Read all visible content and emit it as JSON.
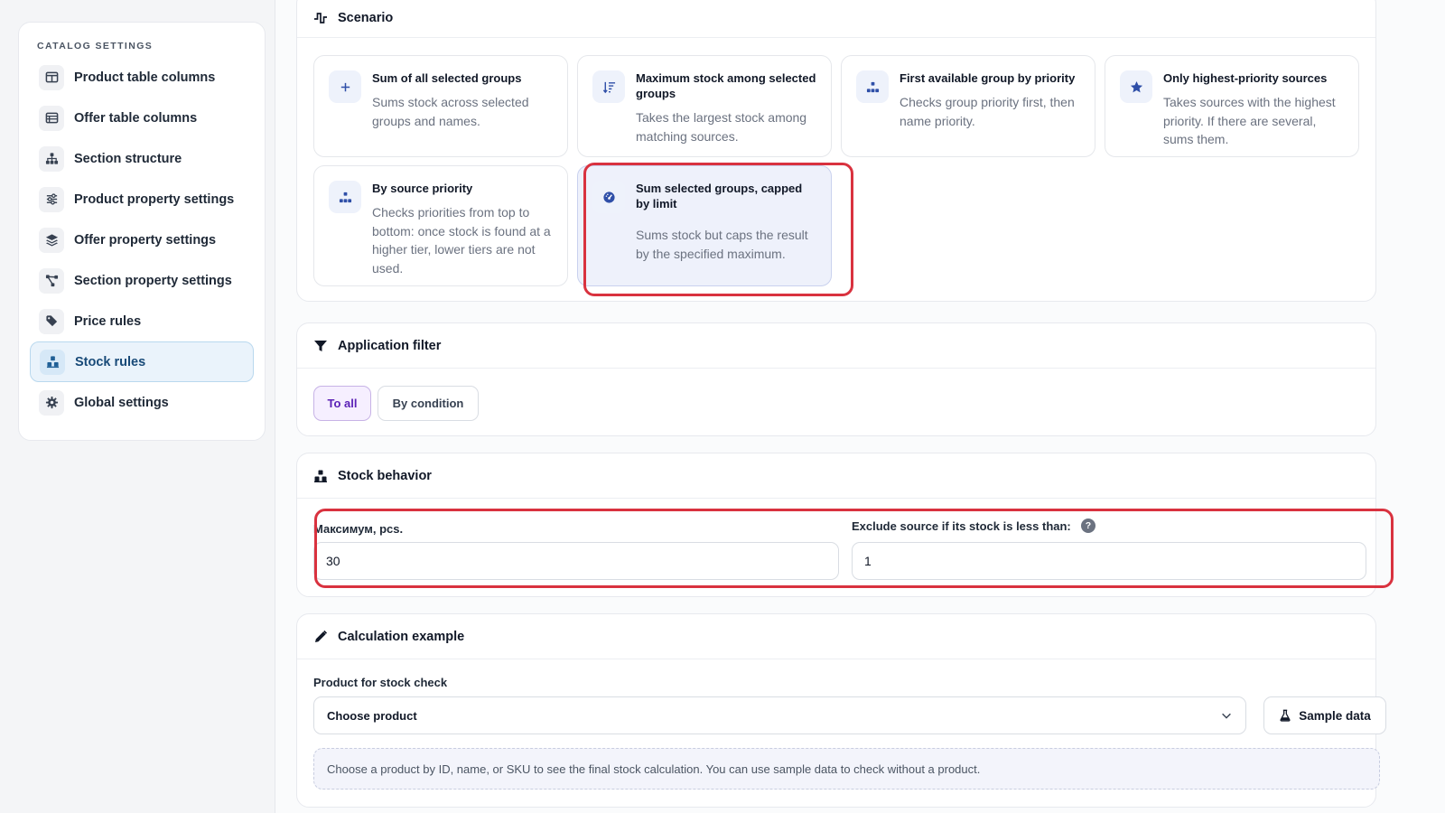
{
  "sidebar": {
    "title": "CATALOG SETTINGS",
    "items": [
      {
        "label": "Product table columns",
        "icon": "table-columns-icon"
      },
      {
        "label": "Offer table columns",
        "icon": "table-list-icon"
      },
      {
        "label": "Section structure",
        "icon": "sitemap-icon"
      },
      {
        "label": "Product property settings",
        "icon": "sliders-icon"
      },
      {
        "label": "Offer property settings",
        "icon": "layers-icon"
      },
      {
        "label": "Section property settings",
        "icon": "nodes-icon"
      },
      {
        "label": "Price rules",
        "icon": "tags-icon"
      },
      {
        "label": "Stock rules",
        "icon": "boxes-icon",
        "active": true
      },
      {
        "label": "Global settings",
        "icon": "gear-icon"
      }
    ]
  },
  "scenario": {
    "title": "Scenario",
    "cards": [
      {
        "title": "Sum of all selected groups",
        "desc": "Sums stock across selected groups and names.",
        "icon": "plus-icon"
      },
      {
        "title": "Maximum stock among selected groups",
        "desc": "Takes the largest stock among matching sources.",
        "icon": "sort-descending-icon"
      },
      {
        "title": "First available group by priority",
        "desc": "Checks group priority first, then name priority.",
        "icon": "hierarchy-icon"
      },
      {
        "title": "Only highest-priority sources",
        "desc": "Takes sources with the highest priority. If there are several, sums them.",
        "icon": "star-icon"
      },
      {
        "title": "By source priority",
        "desc": "Checks priorities from top to bottom: once stock is found at a higher tier, lower tiers are not used.",
        "icon": "hierarchy-icon"
      },
      {
        "title": "Sum selected groups, capped by limit",
        "desc": "Sums stock but caps the result by the specified maximum.",
        "icon": "gauge-icon",
        "selected": true
      }
    ]
  },
  "filter": {
    "title": "Application filter",
    "options": [
      "To all",
      "By condition"
    ],
    "active": "To all"
  },
  "stock_behavior": {
    "title": "Stock behavior",
    "max_label": "Максимум, pcs.",
    "max_value": "30",
    "exclude_label": "Exclude source if its stock is less than:",
    "exclude_value": "1",
    "help": "?"
  },
  "calc": {
    "title": "Calculation example",
    "product_label": "Product for stock check",
    "product_placeholder": "Choose product",
    "sample_button": "Sample data",
    "info": "Choose a product by ID, name, or SKU to see the final stock calculation. You can use sample data to check without a product."
  },
  "colors": {
    "accent": "#2f4fa8",
    "highlight": "#d9323f",
    "active_nav": "#eaf3fb",
    "filter_active": "#5b21b6"
  }
}
